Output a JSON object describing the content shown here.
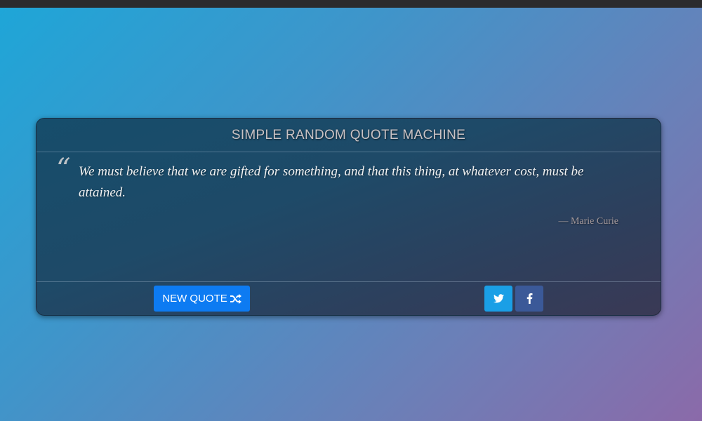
{
  "header": {
    "title": "SIMPLE RANDOM QUOTE MACHINE"
  },
  "quote": {
    "mark": "“",
    "text": "We must believe that we are gifted for something, and that this thing, at whatever cost, must be attained.",
    "author": "— Marie Curie"
  },
  "footer": {
    "new_quote_label": "NEW QUOTE",
    "new_quote_icon": "shuffle-icon",
    "twitter_icon": "twitter-icon",
    "facebook_icon": "facebook-icon"
  },
  "colors": {
    "new_quote_button": "#0d7bf2",
    "twitter": "#1a9fe6",
    "facebook": "#3b5998",
    "background_start": "#1ea6d8",
    "background_end": "#8b6aa9"
  }
}
